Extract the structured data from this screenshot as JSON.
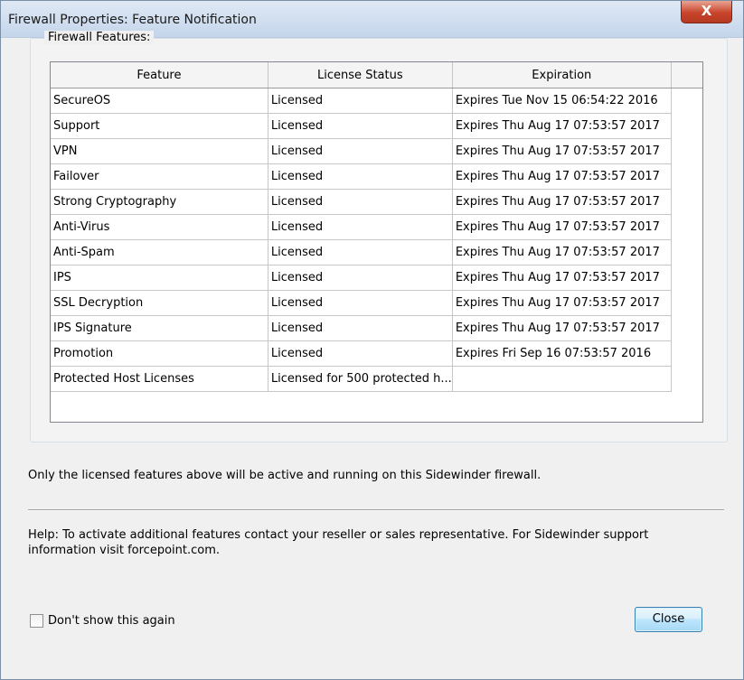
{
  "window": {
    "title": "Firewall Properties: Feature Notification",
    "close_glyph": "X"
  },
  "group": {
    "label": "Firewall Features:"
  },
  "table": {
    "headers": [
      "Feature",
      "License Status",
      "Expiration"
    ],
    "rows": [
      [
        "SecureOS",
        "Licensed",
        "Expires Tue Nov 15 06:54:22 2016"
      ],
      [
        "Support",
        "Licensed",
        "Expires Thu Aug 17 07:53:57 2017"
      ],
      [
        "VPN",
        "Licensed",
        "Expires Thu Aug 17 07:53:57 2017"
      ],
      [
        "Failover",
        "Licensed",
        "Expires Thu Aug 17 07:53:57 2017"
      ],
      [
        "Strong Cryptography",
        "Licensed",
        "Expires Thu Aug 17 07:53:57 2017"
      ],
      [
        "Anti-Virus",
        "Licensed",
        "Expires Thu Aug 17 07:53:57 2017"
      ],
      [
        "Anti-Spam",
        "Licensed",
        "Expires Thu Aug 17 07:53:57 2017"
      ],
      [
        "IPS",
        "Licensed",
        "Expires Thu Aug 17 07:53:57 2017"
      ],
      [
        "SSL Decryption",
        "Licensed",
        "Expires Thu Aug 17 07:53:57 2017"
      ],
      [
        "IPS Signature",
        "Licensed",
        "Expires Thu Aug 17 07:53:57 2017"
      ],
      [
        "Promotion",
        "Licensed",
        "Expires Fri Sep 16 07:53:57 2016"
      ],
      [
        "Protected Host Licenses",
        "Licensed for 500 protected h...",
        ""
      ]
    ]
  },
  "note": "Only the licensed features above will be active and running on this Sidewinder firewall.",
  "help": "Help:  To activate additional features contact your reseller or sales representative.  For Sidewinder support information visit forcepoint.com.",
  "footer": {
    "checkbox_label": "Don't show this again",
    "checkbox_checked": false,
    "close_label": "Close"
  },
  "colors": {
    "close_button_red": "#c8442b",
    "button_border_blue": "#3c7fb1"
  }
}
